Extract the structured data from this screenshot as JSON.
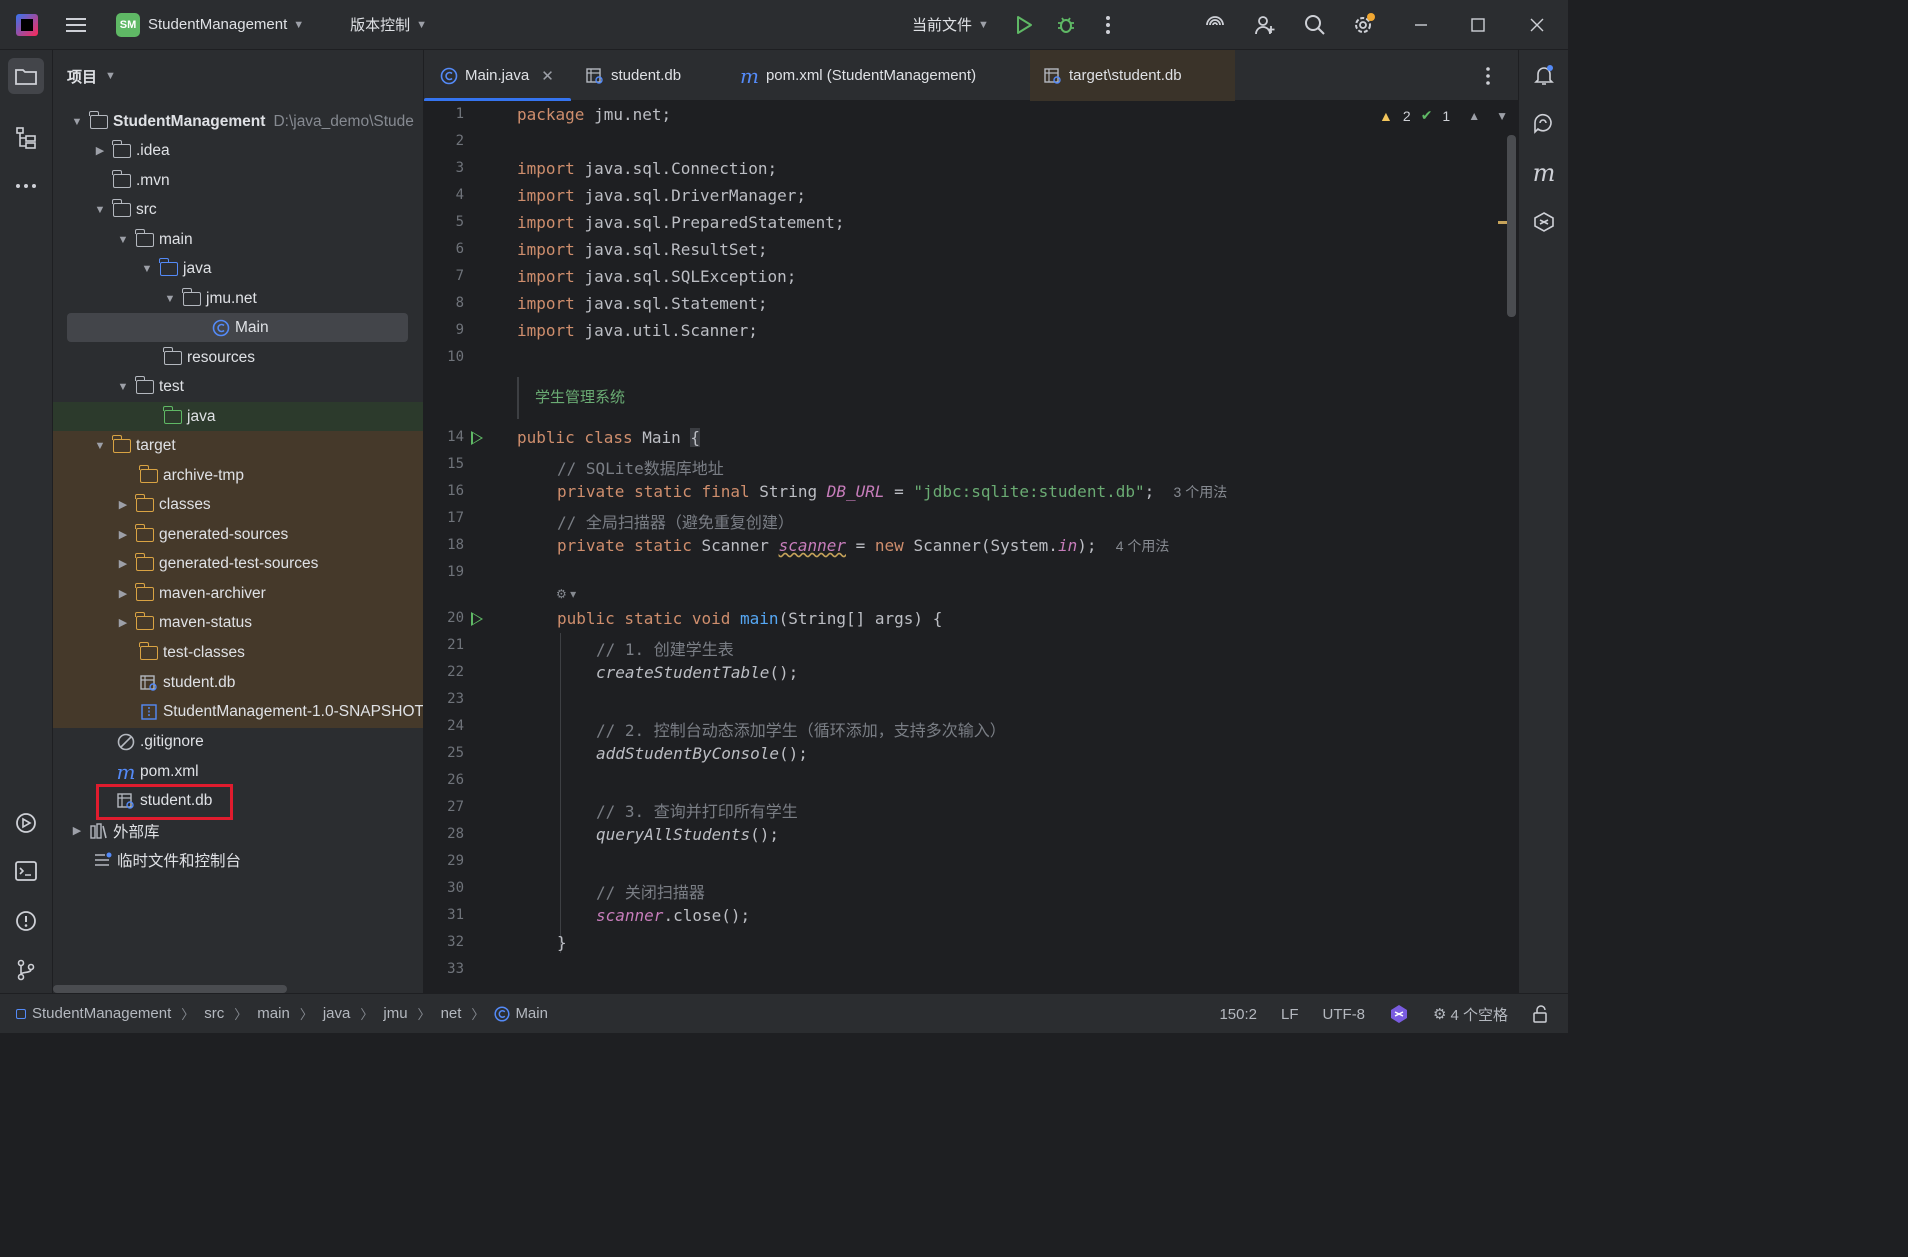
{
  "titlebar": {
    "project_badge": "SM",
    "project_name": "StudentManagement",
    "vcs_label": "版本控制",
    "run_config": "当前文件",
    "icons": [
      "menu-icon",
      "run-icon",
      "debug-icon",
      "more-icon",
      "ai-assistant-icon",
      "add-user-icon",
      "search-icon",
      "settings-icon",
      "minimize-icon",
      "maximize-icon",
      "close-icon"
    ]
  },
  "project_panel": {
    "title": "项目",
    "tree": [
      {
        "label": "StudentManagement",
        "hint": "D:\\java_demo\\Stude"
      },
      {
        "label": ".idea"
      },
      {
        "label": ".mvn"
      },
      {
        "label": "src"
      },
      {
        "label": "main"
      },
      {
        "label": "java"
      },
      {
        "label": "jmu.net"
      },
      {
        "label": "Main"
      },
      {
        "label": "resources"
      },
      {
        "label": "test"
      },
      {
        "label": "java"
      },
      {
        "label": "target"
      },
      {
        "label": "archive-tmp"
      },
      {
        "label": "classes"
      },
      {
        "label": "generated-sources"
      },
      {
        "label": "generated-test-sources"
      },
      {
        "label": "maven-archiver"
      },
      {
        "label": "maven-status"
      },
      {
        "label": "test-classes"
      },
      {
        "label": "student.db"
      },
      {
        "label": "StudentManagement-1.0-SNAPSHOT"
      },
      {
        "label": ".gitignore"
      },
      {
        "label": "pom.xml"
      },
      {
        "label": "student.db"
      },
      {
        "label": "外部库"
      },
      {
        "label": "临时文件和控制台"
      }
    ]
  },
  "tabs": [
    {
      "label": "Main.java"
    },
    {
      "label": "student.db"
    },
    {
      "label": "pom.xml (StudentManagement)"
    },
    {
      "label": "target\\student.db"
    }
  ],
  "inspections": {
    "warnings": "2",
    "ok": "1"
  },
  "editor": {
    "line_numbers": [
      "1",
      "2",
      "3",
      "4",
      "5",
      "6",
      "7",
      "8",
      "9",
      "10",
      "14",
      "15",
      "16",
      "17",
      "18",
      "19",
      "20",
      "21",
      "22",
      "23",
      "24",
      "25",
      "26",
      "27",
      "28",
      "29",
      "30",
      "31",
      "32",
      "33"
    ],
    "package_kw": "package",
    "package_name": " jmu.net;",
    "imports": [
      "java.sql.Connection;",
      "java.sql.DriverManager;",
      "java.sql.PreparedStatement;",
      "java.sql.ResultSet;",
      "java.sql.SQLException;",
      "java.sql.Statement;",
      "java.util.Scanner;"
    ],
    "import_kw": "import",
    "doc_comment": "学生管理系统",
    "class_decl": {
      "kw": "public class",
      "name": " Main ",
      "brace": "{"
    },
    "comment_db": "// SQLite数据库地址",
    "db_url": {
      "kw": "private static final",
      "type": " String ",
      "field": "DB_URL",
      "eq": " = ",
      "value": "\"jdbc:sqlite:student.db\"",
      "end": ";",
      "usage": "3 个用法"
    },
    "comment_scanner": "// 全局扫描器（避免重复创建）",
    "scanner_decl": {
      "kw": "private static",
      "type": " Scanner ",
      "field": "scanner",
      "eq": " = ",
      "new_kw": "new",
      "rest": " Scanner(System.",
      "in": "in",
      "end": ");",
      "usage": "4 个用法"
    },
    "main_decl": {
      "kw": "public static void",
      "name": "main",
      "rest": "(String[] args) {"
    },
    "comment1": "// 1. 创建学生表",
    "call1": "createStudentTable",
    "comment2": "// 2. 控制台动态添加学生（循环添加，支持多次输入）",
    "call2": "addStudentByConsole",
    "comment3": "// 3. 查询并打印所有学生",
    "call3": "queryAllStudents",
    "comment4": "// 关闭扫描器",
    "close_target": "scanner",
    "close_call": ".close();",
    "call_suffix": "();",
    "closing_brace": "}"
  },
  "statusbar": {
    "breadcrumbs": [
      "StudentManagement",
      "src",
      "main",
      "java",
      "jmu",
      "net",
      "Main"
    ],
    "position": "150:2",
    "line_sep": "LF",
    "encoding": "UTF-8",
    "indent": "4 个空格"
  }
}
